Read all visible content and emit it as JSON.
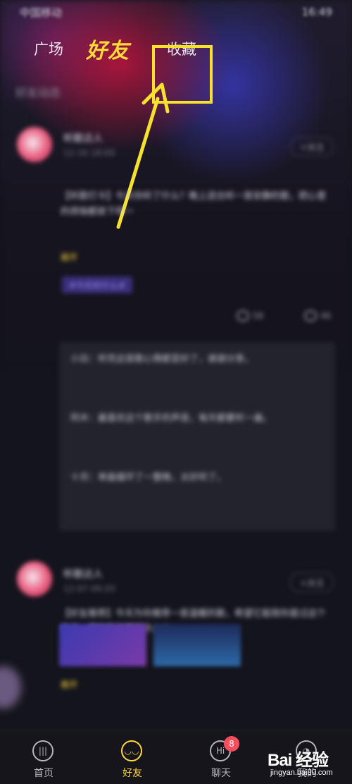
{
  "status_bar": {
    "carrier": "中国移动",
    "time": "16:49"
  },
  "top_tabs": {
    "square": "广场",
    "friends": "好友",
    "favorites": "收藏"
  },
  "feed": {
    "section_label": "好友动态",
    "posts": [
      {
        "author": "听歌达人",
        "time": "12-16 18:00",
        "follow": "+关注",
        "text": "【听歌打卡】今天你听了什么？晚上适合听一首安静的歌，把心里的烦恼都放下吧～",
        "expand": "展开",
        "topic": "#今天听什么#",
        "comment_count": "58",
        "like_count": "46",
        "comments": [
          "小白：听完这首歌心情都变好了，谢谢分享。",
          "阿木：最喜欢这个歌手的声音，每天都要听一遍。",
          "十月：单曲循环了一整晚，太好听了。"
        ]
      },
      {
        "author": "听歌达人",
        "time": "12-07 09:20",
        "follow": "+关注",
        "text": "【好友推荐】今天为你推荐一首温暖的歌，希望它能陪你度过这个冬天，愿你每天都开开心心。",
        "expand": "展开"
      }
    ]
  },
  "bottom_nav": {
    "items": [
      {
        "label": "首页",
        "icon": "sound-wave-icon"
      },
      {
        "label": "好友",
        "icon": "friends-icon",
        "active": true
      },
      {
        "label": "聊天",
        "icon": "chat-icon",
        "badge": "8"
      },
      {
        "label": "我的",
        "icon": "profile-icon"
      }
    ]
  },
  "watermark": {
    "main": "Bai 经验",
    "sub": "jingyan.baidu.com"
  },
  "colors": {
    "accent": "#ffd83a",
    "highlight": "#f6e22d",
    "background": "#14141c",
    "badge": "#ff4d5e"
  }
}
